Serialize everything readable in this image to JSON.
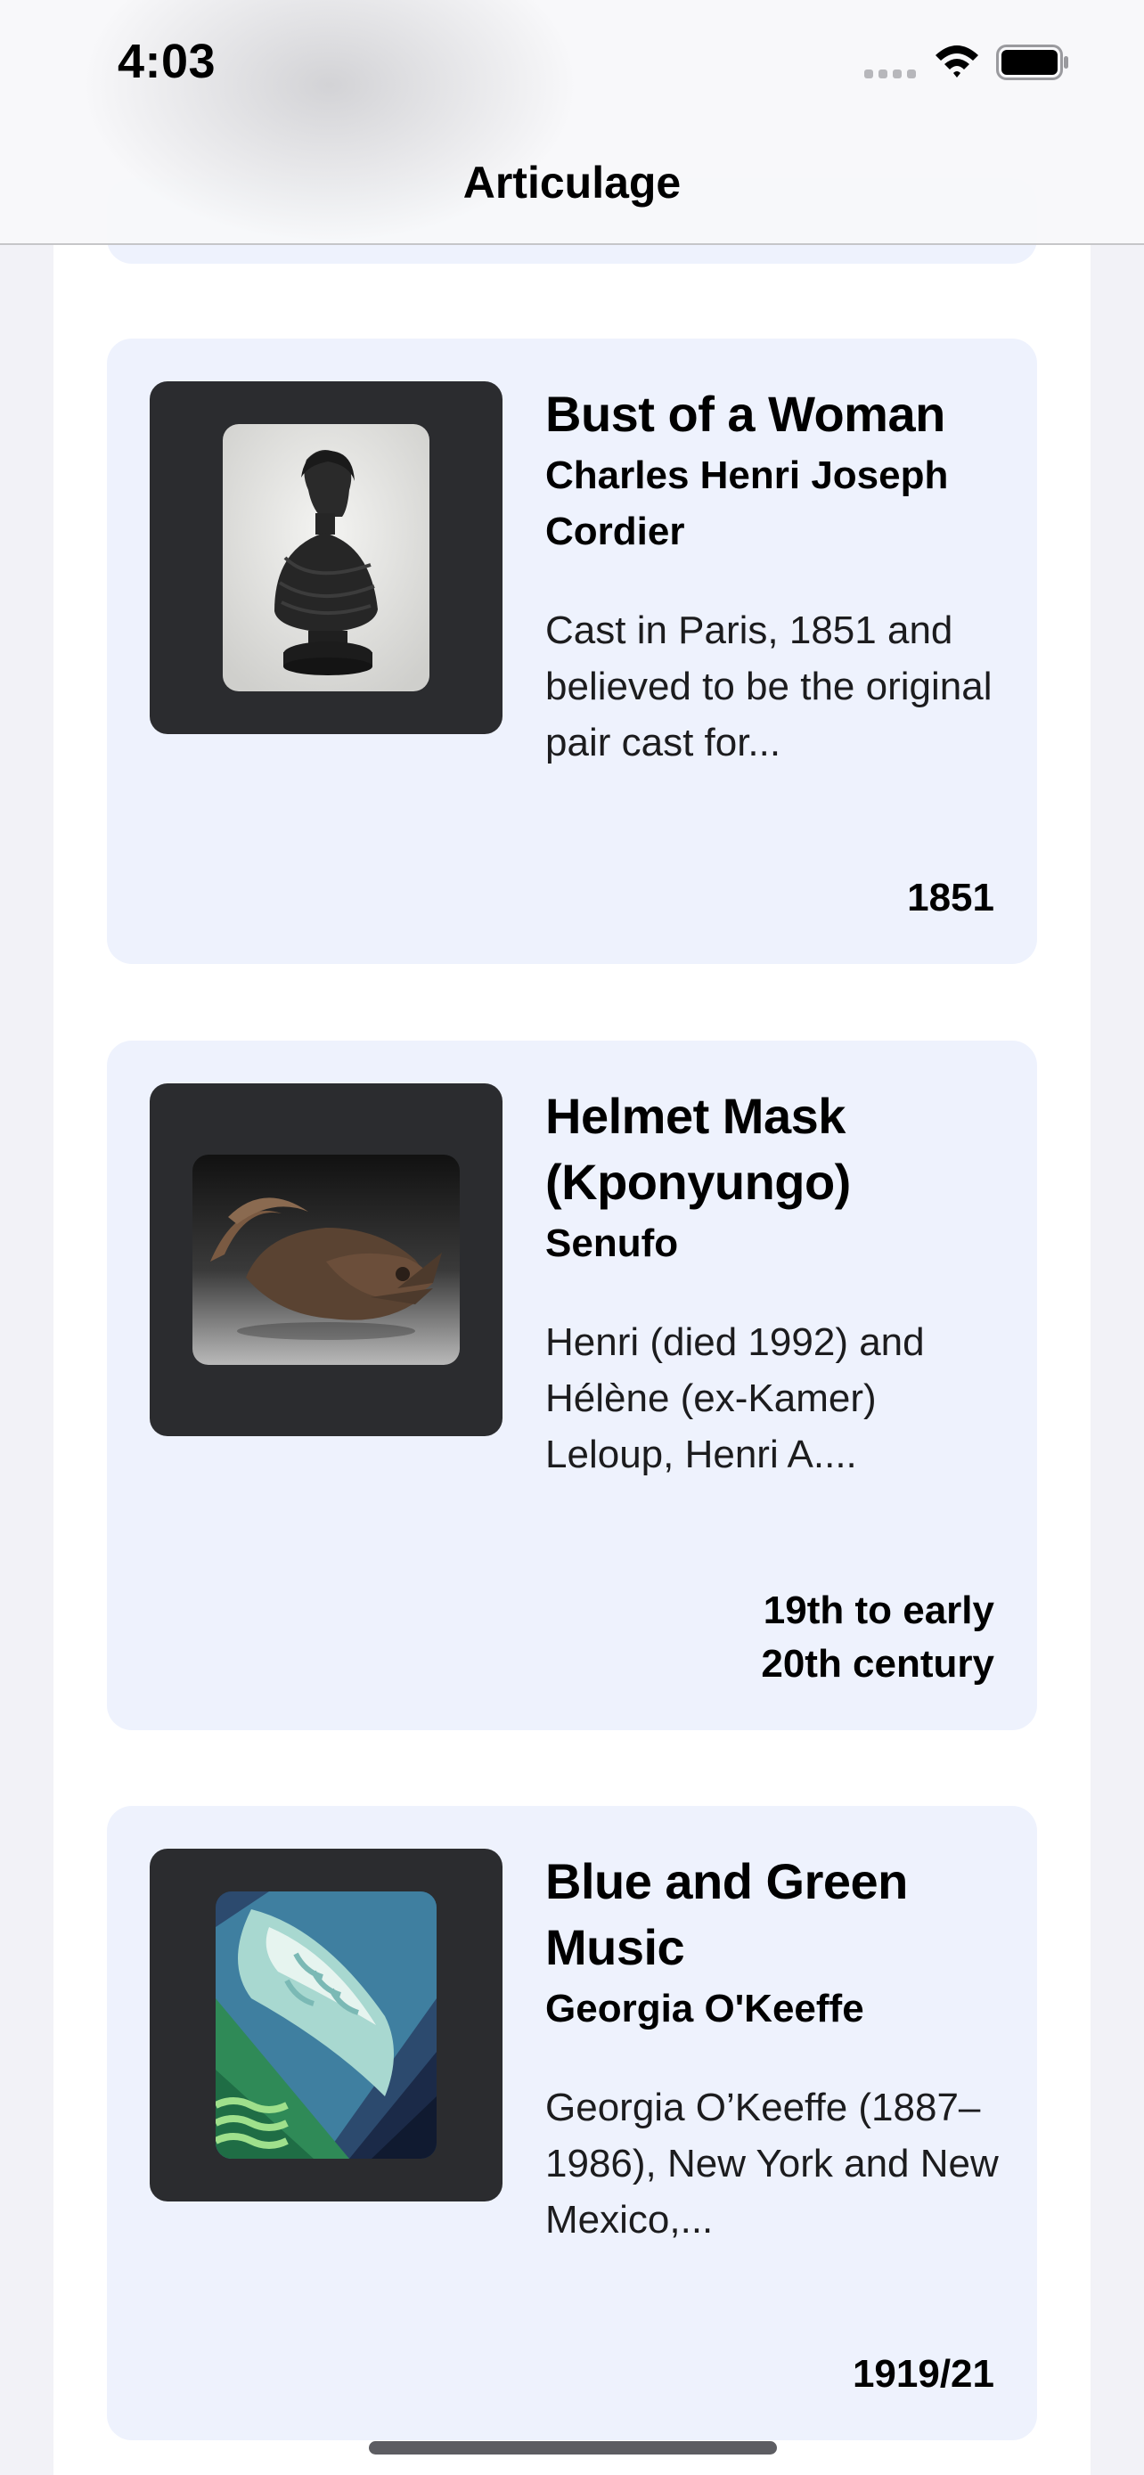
{
  "status_bar": {
    "time": "4:03"
  },
  "nav": {
    "title": "Articulage"
  },
  "artworks": [
    {
      "title": "Bust of a Woman",
      "artist": "Charles Henri Joseph Cordier",
      "description": "Cast in Paris, 1851 and believed to be the original pair cast for...",
      "date": "1851"
    },
    {
      "title": "Helmet Mask (Kponyungo)",
      "artist": "Senufo",
      "description": "Henri (died 1992) and Hélène (ex-Kamer) Leloup, Henri A....",
      "date": "19th to early\n20th century"
    },
    {
      "title": "Blue and Green Music",
      "artist": "Georgia O'Keeffe",
      "description": "Georgia O’Keeffe (1887–1986), New York and New Mexico,...",
      "date": "1919/21"
    }
  ],
  "colors": {
    "card_background": "#eef2fd",
    "thumbnail_frame": "#2b2c2f",
    "page_background": "#f2f2f7"
  },
  "icons": [
    "cellular-signal-icon",
    "wifi-icon",
    "battery-icon"
  ]
}
